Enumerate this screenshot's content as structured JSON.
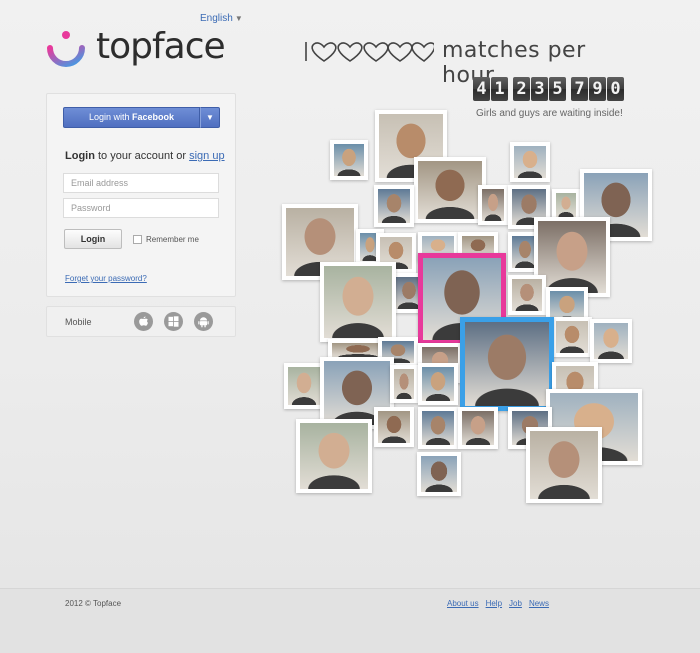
{
  "header": {
    "language": "English",
    "logo_text": "topface",
    "headline_suffix": "matches per hour",
    "counter_digits": [
      "4",
      "1",
      "2",
      "3",
      "5",
      "7",
      "9",
      "0"
    ],
    "waiting_text": "Girls and guys are waiting inside!"
  },
  "login": {
    "facebook_prefix": "Login with ",
    "facebook_brand": "Facebook",
    "title_strong": "Login",
    "title_middle": " to your account or ",
    "signup_link": "sign up",
    "email_placeholder": "Email address",
    "password_placeholder": "Password",
    "login_button": "Login",
    "remember_label": "Remember me",
    "forgot_link": "Forget your password?"
  },
  "mobile": {
    "label": "Mobile",
    "platforms": [
      "apple-icon",
      "windows-icon",
      "android-icon"
    ]
  },
  "footer": {
    "copyright": "2012 © Topface",
    "links": [
      "About us",
      "Help",
      "Job",
      "News"
    ]
  },
  "colors": {
    "brand_blue": "#3b6bb5",
    "facebook_blue": "#4f6fc0",
    "highlight_pink": "#e8399b",
    "highlight_blue": "#3aa0e8"
  }
}
